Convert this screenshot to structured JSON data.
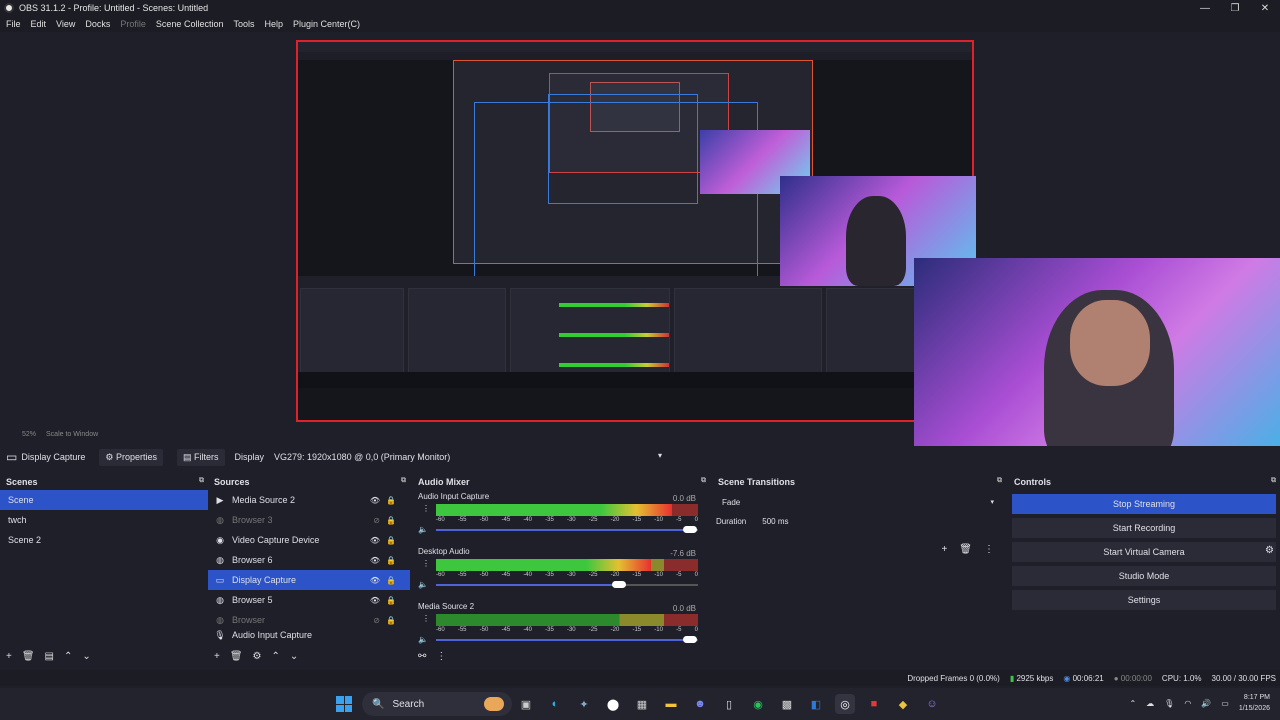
{
  "window": {
    "title": "OBS 31.1.2 - Profile: Untitled - Scenes: Untitled"
  },
  "menu": [
    "File",
    "Edit",
    "View",
    "Docks",
    "Profile",
    "Scene Collection",
    "Tools",
    "Help",
    "Plugin Center(C)"
  ],
  "preview": {
    "zoom": "52%",
    "scale_mode": "Scale to Window"
  },
  "source_bar": {
    "selected_source": "Display Capture",
    "properties_label": "Properties",
    "filters_label": "Filters",
    "display_label": "Display",
    "display_value": "VG279: 1920x1080 @ 0,0 (Primary Monitor)"
  },
  "scenes": {
    "title": "Scenes",
    "items": [
      "Scene",
      "twch",
      "Scene 2"
    ],
    "selected": 0
  },
  "sources": {
    "title": "Sources",
    "items": [
      {
        "name": "Media Source 2",
        "icon": "play-icon",
        "visible": true
      },
      {
        "name": "Browser 3",
        "icon": "browser-icon",
        "visible": false
      },
      {
        "name": "Video Capture Device",
        "icon": "camera-icon",
        "visible": true
      },
      {
        "name": "Browser 6",
        "icon": "browser-icon",
        "visible": true
      },
      {
        "name": "Display Capture",
        "icon": "monitor-icon",
        "visible": true
      },
      {
        "name": "Browser 5",
        "icon": "browser-icon",
        "visible": true
      },
      {
        "name": "Browser",
        "icon": "browser-icon",
        "visible": false
      },
      {
        "name": "Audio Input Capture",
        "icon": "mic-icon",
        "visible": true
      }
    ],
    "selected": 4
  },
  "mixer": {
    "title": "Audio Mixer",
    "ticks": [
      "-60",
      "-55",
      "-50",
      "-45",
      "-40",
      "-35",
      "-30",
      "-25",
      "-20",
      "-15",
      "-10",
      "-5",
      "0"
    ],
    "channels": [
      {
        "name": "Audio Input Capture",
        "db": "0.0 dB",
        "level": 0.9,
        "volume": 0.97
      },
      {
        "name": "Desktop Audio",
        "db": "-7.6 dB",
        "level": 0.82,
        "volume": 0.7
      },
      {
        "name": "Media Source 2",
        "db": "0.0 dB",
        "level": 0.0,
        "volume": 0.97
      }
    ]
  },
  "transitions": {
    "title": "Scene Transitions",
    "selected": "Fade",
    "duration_label": "Duration",
    "duration_value": "500 ms"
  },
  "controls": {
    "title": "Controls",
    "buttons": [
      "Stop Streaming",
      "Start Recording",
      "Start Virtual Camera",
      "Studio Mode",
      "Settings"
    ]
  },
  "status": {
    "dropped": "Dropped Frames 0 (0.0%)",
    "bitrate": "2925 kbps",
    "stream_time": "00:06:21",
    "rec_time": "00:00:00",
    "cpu": "CPU: 1.0%",
    "fps": "30.00 / 30.00 FPS"
  },
  "taskbar": {
    "search": "Search",
    "time": "8:17 PM",
    "date": "1/15/2026"
  },
  "colors": {
    "accent": "#2c54c8",
    "bg": "#1e1f29",
    "preview_border": "#e0202a"
  }
}
